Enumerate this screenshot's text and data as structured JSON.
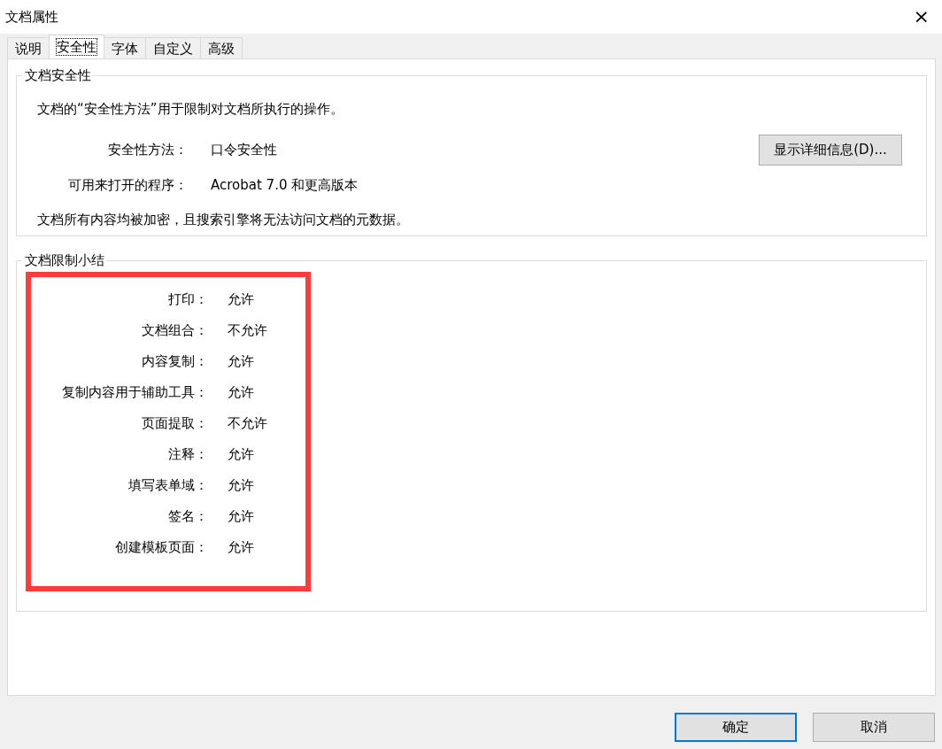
{
  "window": {
    "title": "文档属性",
    "close": "×"
  },
  "tabs": [
    {
      "label": "说明",
      "selected": false
    },
    {
      "label": "安全性",
      "selected": true
    },
    {
      "label": "字体",
      "selected": false
    },
    {
      "label": "自定义",
      "selected": false
    },
    {
      "label": "高级",
      "selected": false
    }
  ],
  "security": {
    "title": "文档安全性",
    "intro": "文档的“安全性方法”用于限制对文档所执行的操作。",
    "fields": [
      {
        "label": "安全性方法：",
        "value": "口令安全性"
      },
      {
        "label": "可用来打开的程序：",
        "value": "Acrobat 7.0 和更高版本"
      }
    ],
    "details_button": "显示详细信息(D)...",
    "note": "文档所有内容均被加密，且搜索引擎将无法访问文档的元数据。"
  },
  "restrictions": {
    "title": "文档限制小结",
    "highlighted": true,
    "rows": [
      {
        "label": "打印：",
        "value": "允许"
      },
      {
        "label": "文档组合：",
        "value": "不允许"
      },
      {
        "label": "内容复制：",
        "value": "允许"
      },
      {
        "label": "复制内容用于辅助工具：",
        "value": "允许"
      },
      {
        "label": "页面提取：",
        "value": "不允许"
      },
      {
        "label": "注释：",
        "value": "允许"
      },
      {
        "label": "填写表单域：",
        "value": "允许"
      },
      {
        "label": "签名：",
        "value": "允许"
      },
      {
        "label": "创建模板页面：",
        "value": "允许"
      }
    ]
  },
  "buttons": [
    {
      "label": "确定",
      "focused": true
    },
    {
      "label": "取消",
      "focused": false
    }
  ]
}
